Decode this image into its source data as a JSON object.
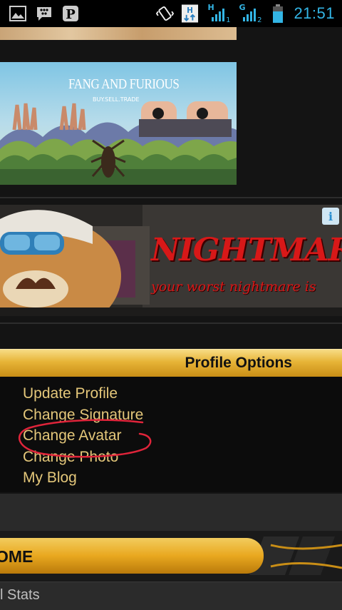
{
  "status_bar": {
    "icons": [
      "gallery-icon",
      "bbm-icon",
      "pinterest-icon",
      "vibrate-icon",
      "sync-icon"
    ],
    "net1_type": "H",
    "net1_slot": "1",
    "net2_type": "G",
    "net2_slot": "2",
    "time": "21:51",
    "accent_color": "#33b5e5"
  },
  "banner": {
    "title": "FANG AND FURIOUS",
    "subtitle": "BUY.SELL.TRADE"
  },
  "ad": {
    "title": "NIGHTMAR",
    "tagline": "your worst nightmare is",
    "info_label": "i"
  },
  "profile_options": {
    "header": "Profile Options",
    "items": [
      {
        "label": "Update Profile"
      },
      {
        "label": "Change Signature"
      },
      {
        "label": "Change Avatar"
      },
      {
        "label": "Change Photo"
      },
      {
        "label": "My Blog"
      }
    ],
    "accent_color": "#e4c77a"
  },
  "nav": {
    "home_label": "OME",
    "stats_label": "l Stats"
  }
}
